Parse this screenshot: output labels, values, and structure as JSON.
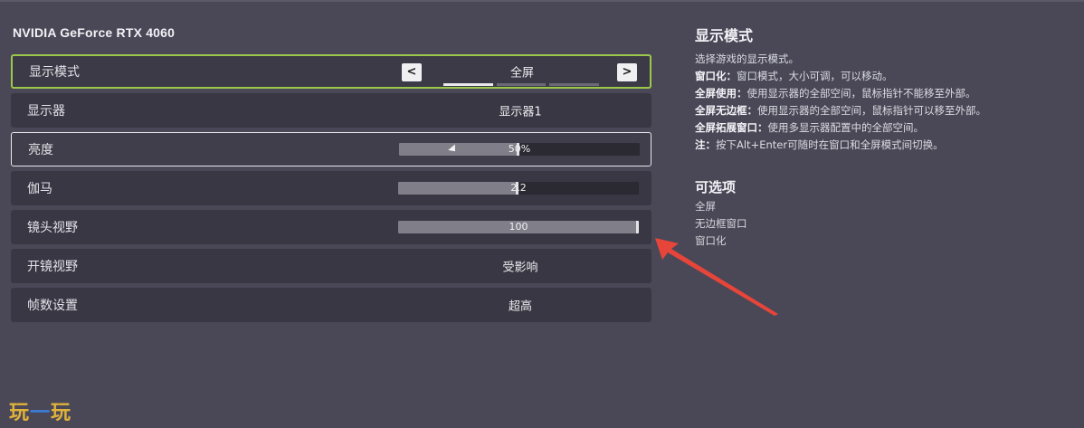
{
  "gpu_name": "NVIDIA GeForce RTX 4060",
  "settings": {
    "display_mode": {
      "label": "显示模式",
      "value": "全屏",
      "prev": "<",
      "next": ">",
      "page_count": 3,
      "page_index": 0
    },
    "monitor": {
      "label": "显示器",
      "value": "显示器1"
    },
    "brightness": {
      "label": "亮度",
      "value_text": "50%",
      "fraction": 0.5
    },
    "gamma": {
      "label": "伽马",
      "value_text": "2.2",
      "fraction": 0.5
    },
    "fov": {
      "label": "镜头视野",
      "value_text": "100",
      "fraction": 1.0
    },
    "ads_fov": {
      "label": "开镜视野",
      "value": "受影响"
    },
    "fps": {
      "label": "帧数设置",
      "value": "超高"
    }
  },
  "description": {
    "title": "显示模式",
    "intro": "选择游戏的显示模式。",
    "lines": [
      {
        "term": "窗口化：",
        "text": "窗口模式，大小可调，可以移动。"
      },
      {
        "term": "全屏使用：",
        "text": "使用显示器的全部空间，鼠标指针不能移至外部。"
      },
      {
        "term": "全屏无边框：",
        "text": "使用显示器的全部空间，鼠标指针可以移至外部。"
      },
      {
        "term": "全屏拓展窗口：",
        "text": "使用多显示器配置中的全部空间。"
      },
      {
        "term": "注：",
        "text": "按下Alt+Enter可随时在窗口和全屏模式间切换。"
      }
    ],
    "options_title": "可选项",
    "options": [
      "全屏",
      "无边框窗口",
      "窗口化"
    ]
  },
  "watermark": {
    "left": "玩",
    "dash": "一",
    "right": "玩"
  },
  "colors": {
    "background": "#4a4857",
    "row": "#393743",
    "focus_border": "#9cc84a",
    "annotation_arrow": "#e8453a",
    "watermark": "#e0b23a"
  }
}
